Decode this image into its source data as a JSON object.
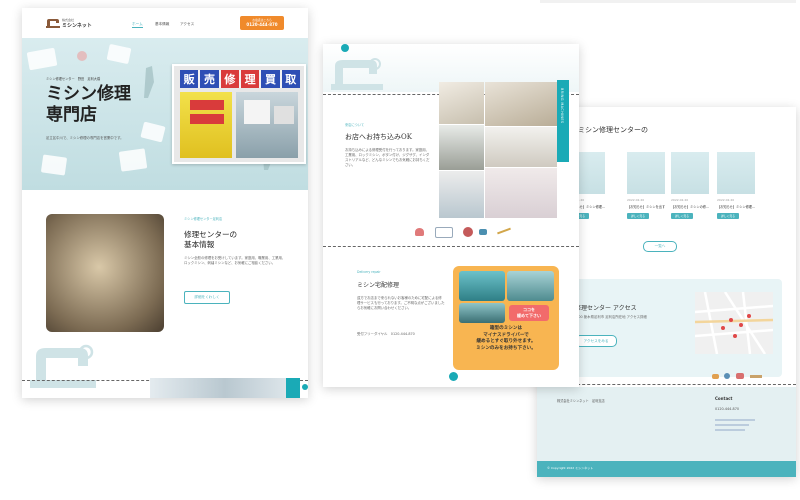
{
  "brand": {
    "small": "株式会社",
    "name": "ミシンネット"
  },
  "page1": {
    "nav": [
      "ホーム",
      "基本情報",
      "アクセス"
    ],
    "phone": {
      "label": "お電話はこちら",
      "number": "0120-444-870"
    },
    "hero_subtitle": "ミシン修理センター　野田　足利大橋",
    "hero_title_line1": "ミシン修理",
    "hero_title_line2": "専門店",
    "hero_text": "足立区中川で、ミシン修理の専門店を営業中です。",
    "storefront_sign": [
      "販",
      "売",
      "修",
      "理",
      "買",
      "取"
    ],
    "section_label": "ミシン修理センター足利店",
    "info_title_line1": "修理センターの",
    "info_title_line2": "基本情報",
    "info_text": "ミシン全般の修理をお受けしています。家庭用、職業用、工業用、ロックミシン、刺繍ミシンなど、お気軽にご相談ください。",
    "info_button": "詳細をくわしく"
  },
  "page2": {
    "section1_label": "来店について",
    "section1_title": "お店へお持ち込みOK",
    "section1_text": "お持ち込みによる修理受付を行っております。家庭用、工業用、ロックミシン、ボタン付け、ジグザグ、インダストリアルなど、どんなミシンでもお気軽にお持ちください。",
    "vertical_tab": "BRING MACHINES",
    "section2_label": "Delivery repair",
    "section2_title": "ミシン宅配修理",
    "section2_text": "遠方でお店まで来られないお客様のために宅配による修理サービスも行っております。ご不明な点がございましたらお気軽にお問い合わせください。",
    "section2_phone": "受付フリーダイヤル　0120-444-870",
    "callout_bubble_line1": "ココを",
    "callout_bubble_line2": "緩めて下さい",
    "callout_text_line1": "箱型のミシンは",
    "callout_text_line2": "マイナスドライバーで",
    "callout_text_line3": "緩めるとすぐ取り外せます。",
    "callout_text_line4": "ミシンのみをお持ち下さい。"
  },
  "page3": {
    "news_heading": "ミシン修理センターの",
    "news": [
      {
        "date": "2022.02.20",
        "title": "【お知らせ】ミシン修理…",
        "button": "詳しく見る"
      },
      {
        "date": "2022.02.20",
        "title": "【お知らせ】ミシンを出す…",
        "button": "詳しく見る"
      },
      {
        "date": "2022.02.20",
        "title": "【お知らせ】ミシンの修…",
        "button": "詳しく見る"
      },
      {
        "date": "2022.02.20",
        "title": "【お知らせ】ミシン修理…",
        "button": "詳しく見る"
      }
    ],
    "more_button": "一覧へ",
    "access_label": "Access",
    "access_title": "足利修理センター アクセス",
    "access_text": "〒326-0000 栃木県足利市 足利店所在地 アクセス詳細",
    "access_button": "アクセスをみる",
    "footer_brand": "株式会社ミシンネット　足利支店",
    "contact_heading": "Contact",
    "contact_phone": "0120-444-870",
    "footer_copyright": "© Copyright 2022 ミシンネット"
  }
}
